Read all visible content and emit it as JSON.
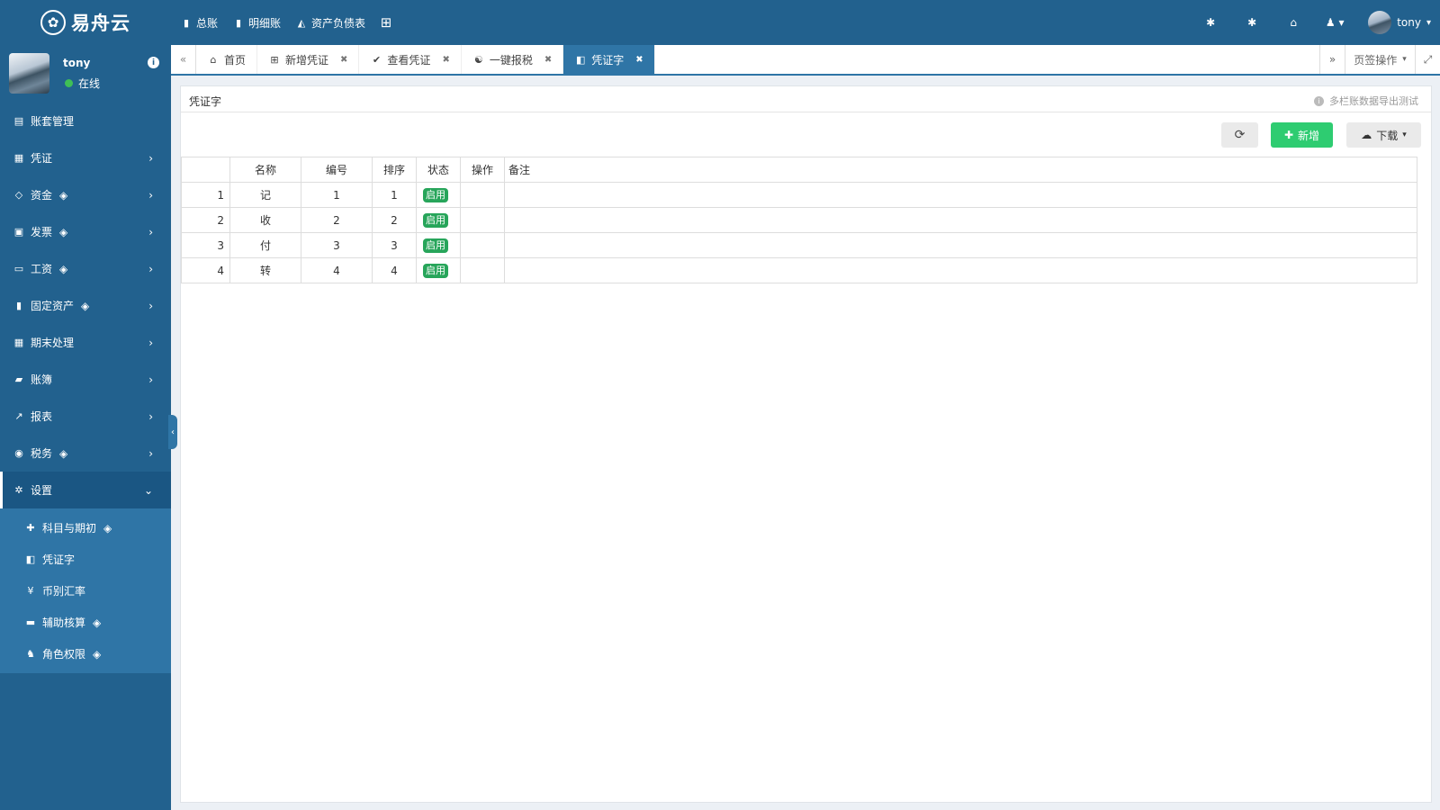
{
  "header": {
    "logo_text": "易舟云",
    "nav": [
      {
        "label": "总账",
        "icon": "bookmark-icon"
      },
      {
        "label": "明细账",
        "icon": "bookmark-icon"
      },
      {
        "label": "资产负债表",
        "icon": "area-chart-icon"
      }
    ],
    "right_icons": [
      "bug-icon",
      "bug-icon",
      "home-icon",
      "user-menu-icon"
    ],
    "user_name": "tony"
  },
  "sidebar": {
    "user": {
      "name": "tony",
      "status": "在线"
    },
    "menu": [
      {
        "label": "账套管理",
        "icon": "book-icon",
        "gem": false,
        "arrow": false
      },
      {
        "label": "凭证",
        "icon": "voucher-icon",
        "gem": false,
        "arrow": true
      },
      {
        "label": "资金",
        "icon": "code-icon",
        "gem": true,
        "arrow": true
      },
      {
        "label": "发票",
        "icon": "invoice-icon",
        "gem": true,
        "arrow": true
      },
      {
        "label": "工资",
        "icon": "card-icon",
        "gem": true,
        "arrow": true
      },
      {
        "label": "固定资产",
        "icon": "building-icon",
        "gem": true,
        "arrow": true
      },
      {
        "label": "期末处理",
        "icon": "calendar-icon",
        "gem": false,
        "arrow": true
      },
      {
        "label": "账簿",
        "icon": "ledger-icon",
        "gem": false,
        "arrow": true
      },
      {
        "label": "报表",
        "icon": "line-chart-icon",
        "gem": false,
        "arrow": true
      },
      {
        "label": "税务",
        "icon": "compass-icon",
        "gem": true,
        "arrow": true
      },
      {
        "label": "设置",
        "icon": "gear-icon",
        "gem": false,
        "arrow": true,
        "active": true
      }
    ],
    "submenu": [
      {
        "label": "科目与期初",
        "icon": "puzzle-icon",
        "gem": true
      },
      {
        "label": "凭证字",
        "icon": "voucher-word-icon",
        "gem": false
      },
      {
        "label": "币别汇率",
        "icon": "yen-icon",
        "gem": false
      },
      {
        "label": "辅助核算",
        "icon": "folder-icon",
        "gem": true
      },
      {
        "label": "角色权限",
        "icon": "users-icon",
        "gem": true
      }
    ]
  },
  "tabs": [
    {
      "label": "首页",
      "icon": "home-icon",
      "closable": false
    },
    {
      "label": "新增凭证",
      "icon": "plus-square-icon",
      "closable": true
    },
    {
      "label": "查看凭证",
      "icon": "check-circle-icon",
      "closable": true
    },
    {
      "label": "一键报税",
      "icon": "rebel-icon",
      "closable": true
    },
    {
      "label": "凭证字",
      "icon": "voucher-word-icon",
      "closable": true,
      "active": true
    }
  ],
  "tab_ops_label": "页签操作",
  "panel": {
    "title": "凭证字",
    "tip": "多栏账数据导出测试",
    "add_label": "新增",
    "download_label": "下载"
  },
  "table": {
    "columns": [
      "名称",
      "编号",
      "排序",
      "状态",
      "操作",
      "备注"
    ],
    "rows": [
      {
        "idx": "1",
        "name": "记",
        "code": "1",
        "sort": "1",
        "status": "启用"
      },
      {
        "idx": "2",
        "name": "收",
        "code": "2",
        "sort": "2",
        "status": "启用"
      },
      {
        "idx": "3",
        "name": "付",
        "code": "3",
        "sort": "3",
        "status": "启用"
      },
      {
        "idx": "4",
        "name": "转",
        "code": "4",
        "sort": "4",
        "status": "启用"
      }
    ]
  },
  "colors": {
    "primary": "#22618e",
    "active_tab": "#2f75a6",
    "success": "#2ecc71",
    "badge": "#27a55a"
  }
}
